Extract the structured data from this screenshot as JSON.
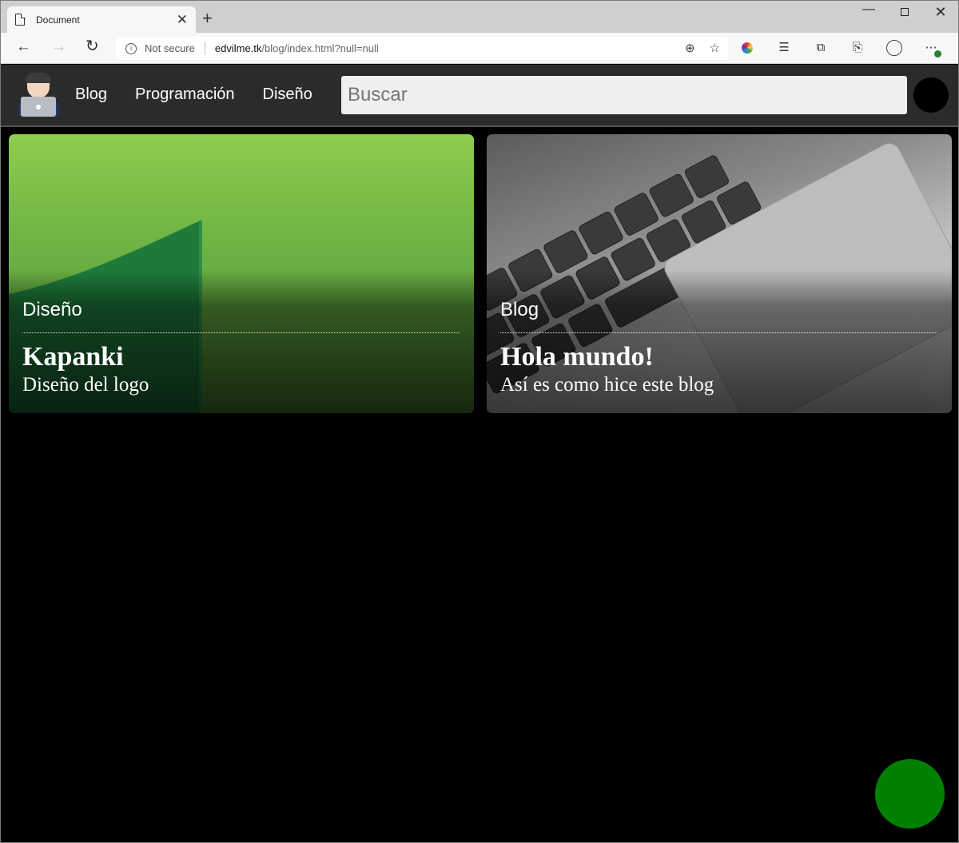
{
  "browser": {
    "tab_title": "Document",
    "tab_close": "✕",
    "new_tab": "+",
    "security_label": "Not secure",
    "url_host": "edvilme.tk",
    "url_path": "/blog/index.html?null=null",
    "window_controls": {
      "minimize": "—",
      "maximize": "",
      "close": "✕"
    }
  },
  "site": {
    "nav": [
      "Blog",
      "Programación",
      "Diseño"
    ],
    "search_placeholder": "Buscar"
  },
  "cards": [
    {
      "category": "Diseño",
      "title": "Kapanki",
      "subtitle": "Diseño del logo",
      "accent": "#8dcd4e"
    },
    {
      "category": "Blog",
      "title": "Hola mundo!",
      "subtitle": "Así es como hice este blog",
      "accent": "#bdbdbd"
    }
  ],
  "colors": {
    "background": "#000000",
    "header": "#2b2b2b",
    "fab": "#008000"
  },
  "icons": [
    "document-icon",
    "back-arrow-icon",
    "forward-arrow-icon",
    "reload-icon",
    "info-icon",
    "zoom-icon",
    "star-icon",
    "color-wheel-icon",
    "favorites-icon",
    "collections-icon",
    "share-icon",
    "profile-icon",
    "more-icon"
  ]
}
